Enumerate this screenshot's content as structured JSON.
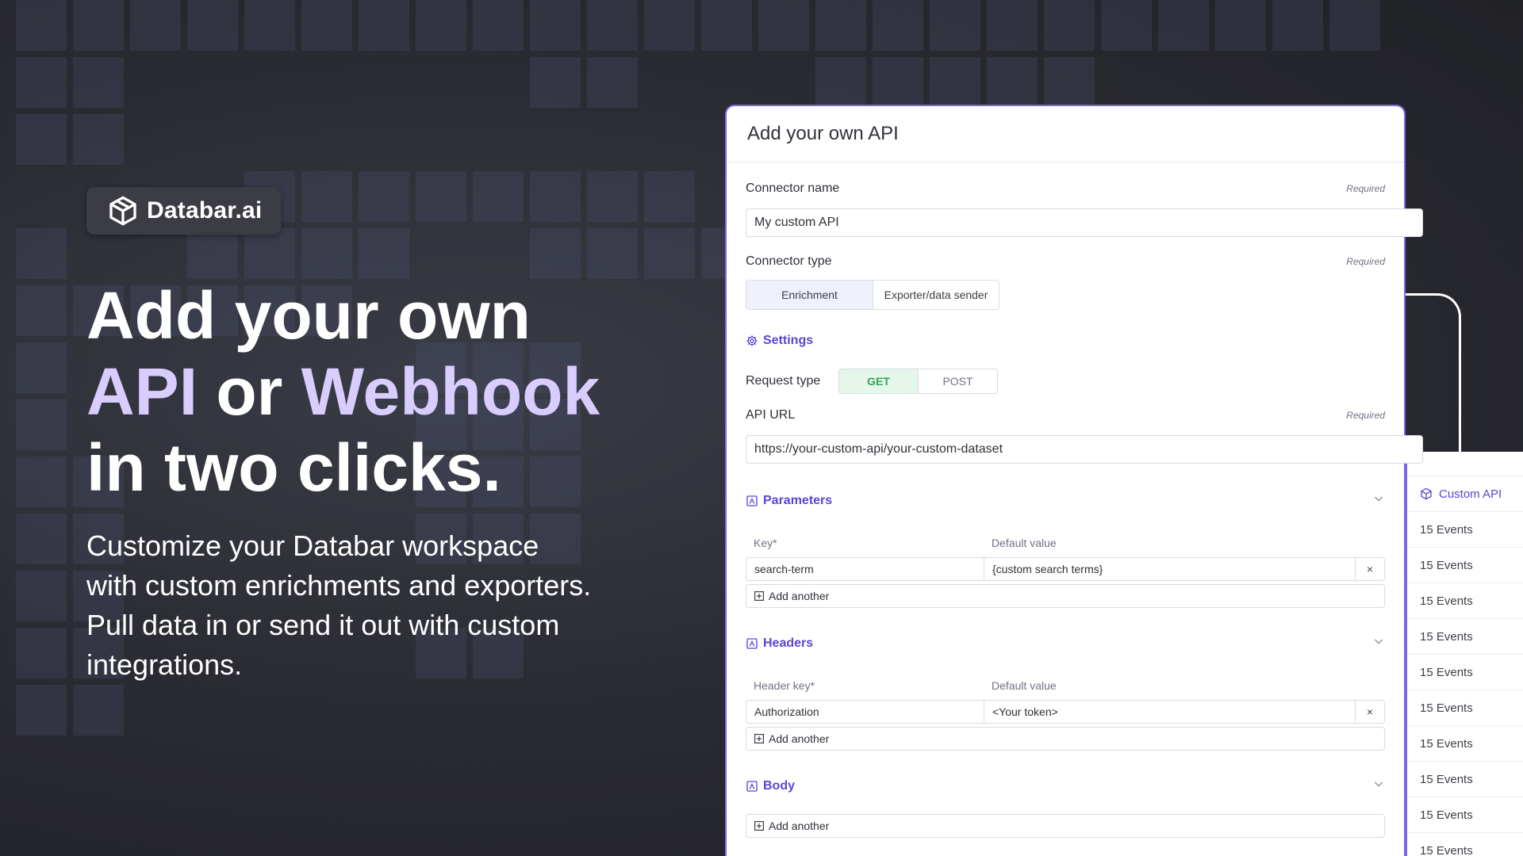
{
  "brand": {
    "name": "Databar.ai",
    "icon": "cube-icon"
  },
  "hero": {
    "line1": "Add your own",
    "line2_part1": "API",
    "line2_part2": " or ",
    "line2_part3": "Webhook",
    "line3": "in two clicks.",
    "description": "Customize your Databar workspace with custom enrichments and exporters. Pull data in or send it out with custom integrations."
  },
  "colors": {
    "accent": "#5b45d6",
    "highlight": "#d9ccff",
    "card_border": "#7a66e8",
    "get_green": "#2fa55a"
  },
  "form": {
    "title": "Add your own API",
    "connector_name": {
      "label": "Connector name",
      "required": "Required",
      "value": "My custom API"
    },
    "connector_type": {
      "label": "Connector type",
      "required": "Required",
      "options": [
        "Enrichment",
        "Exporter/data sender"
      ],
      "selected": "Enrichment"
    },
    "settings": {
      "title": "Settings",
      "icon": "gear-icon"
    },
    "request_type": {
      "label": "Request type",
      "options": [
        "GET",
        "POST"
      ],
      "selected": "GET"
    },
    "api_url": {
      "label": "API URL",
      "required": "Required",
      "value": "https://your-custom-api/your-custom-dataset"
    },
    "parameters": {
      "title": "Parameters",
      "col_key": "Key*",
      "col_default": "Default value",
      "rows": [
        {
          "key": "search-term",
          "value": "{custom search terms}"
        }
      ],
      "add_label": "Add another"
    },
    "headers": {
      "title": "Headers",
      "col_key": "Header key*",
      "col_default": "Default value",
      "rows": [
        {
          "key": "Authorization",
          "value": "<Your token>"
        }
      ],
      "add_label": "Add another"
    },
    "body": {
      "title": "Body",
      "add_label": "Add another"
    },
    "remove_symbol": "×"
  },
  "events_panel": {
    "title": "Custom API",
    "items": [
      "15 Events",
      "15 Events",
      "15 Events",
      "15 Events",
      "15 Events",
      "15 Events",
      "15 Events",
      "15 Events",
      "15 Events",
      "15 Events"
    ]
  }
}
